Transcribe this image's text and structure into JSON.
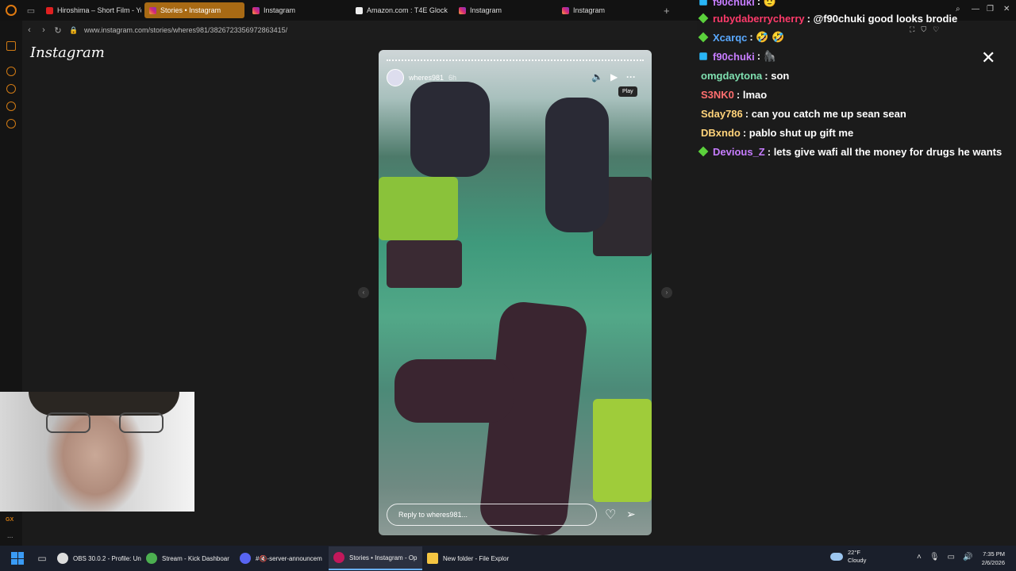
{
  "browser": {
    "tabs": [
      {
        "label": "Hiroshima – Short Film - Yo",
        "icon": "youtube-icon",
        "active": false
      },
      {
        "label": "Stories • Instagram",
        "icon": "instagram-icon",
        "active": true
      },
      {
        "label": "Instagram",
        "icon": "instagram-icon",
        "active": false
      },
      {
        "label": "Amazon.com : T4E Glock",
        "icon": "amazon-icon",
        "active": false
      },
      {
        "label": "Instagram",
        "icon": "instagram-icon",
        "active": false
      },
      {
        "label": "Instagram",
        "icon": "instagram-icon",
        "active": false
      }
    ],
    "new_tab": "+",
    "url": "www.instagram.com/stories/wheres981/3826723356972863415/",
    "accent": "#a86a14"
  },
  "instagram": {
    "logo": "Instagram",
    "story": {
      "username": "wheres981",
      "time": "6h",
      "tooltip": "Play",
      "reply_placeholder": "Reply to wheres981..."
    }
  },
  "chat": [
    {
      "user": "f90chuki",
      "color": "#c77dff",
      "badge": "blue",
      "text": ": 🫡"
    },
    {
      "user": "rubydaberrycherry",
      "color": "#ff3b6b",
      "badge": "green",
      "text": ": @f90chuki good looks brodie"
    },
    {
      "user": "Xcarqc",
      "color": "#5aa9ff",
      "badge": "green",
      "text": ": 🤣 🤣"
    },
    {
      "user": "f90chuki",
      "color": "#c77dff",
      "badge": "blue",
      "text": ": 🦍"
    },
    {
      "user": "omgdaytona",
      "color": "#7fe0b0",
      "badge": "none",
      "text": ": son"
    },
    {
      "user": "S3NK0",
      "color": "#ff6f6f",
      "badge": "none",
      "text": ": lmao"
    },
    {
      "user": "Sday786",
      "color": "#ffd37a",
      "badge": "none",
      "text": ": can you catch me up sean sean"
    },
    {
      "user": "DBxndo",
      "color": "#ffd37a",
      "badge": "none",
      "text": ": pablo shut up gift me"
    },
    {
      "user": "Devious_Z",
      "color": "#c77dff",
      "badge": "green",
      "text": ": lets give wafi all the money for drugs he wants"
    }
  ],
  "sidebar": {
    "gx": "GX",
    "more": "..."
  },
  "taskbar": {
    "items": [
      {
        "label": "OBS 30.0.2 - Profile: Unt",
        "color": "#ddd",
        "active": false
      },
      {
        "label": "Stream - Kick Dashboar",
        "color": "#4caf50",
        "active": false
      },
      {
        "label": "#🔇-server-announcem",
        "color": "#5865f2",
        "active": false
      },
      {
        "label": "Stories • Instagram - Op",
        "color": "#c2185b",
        "active": true
      },
      {
        "label": "New folder - File Explor",
        "color": "#f4c542",
        "active": false
      }
    ],
    "weather_temp": "22°F",
    "weather_desc": "Cloudy",
    "time": "7:35 PM",
    "date": "2/6/2026"
  }
}
